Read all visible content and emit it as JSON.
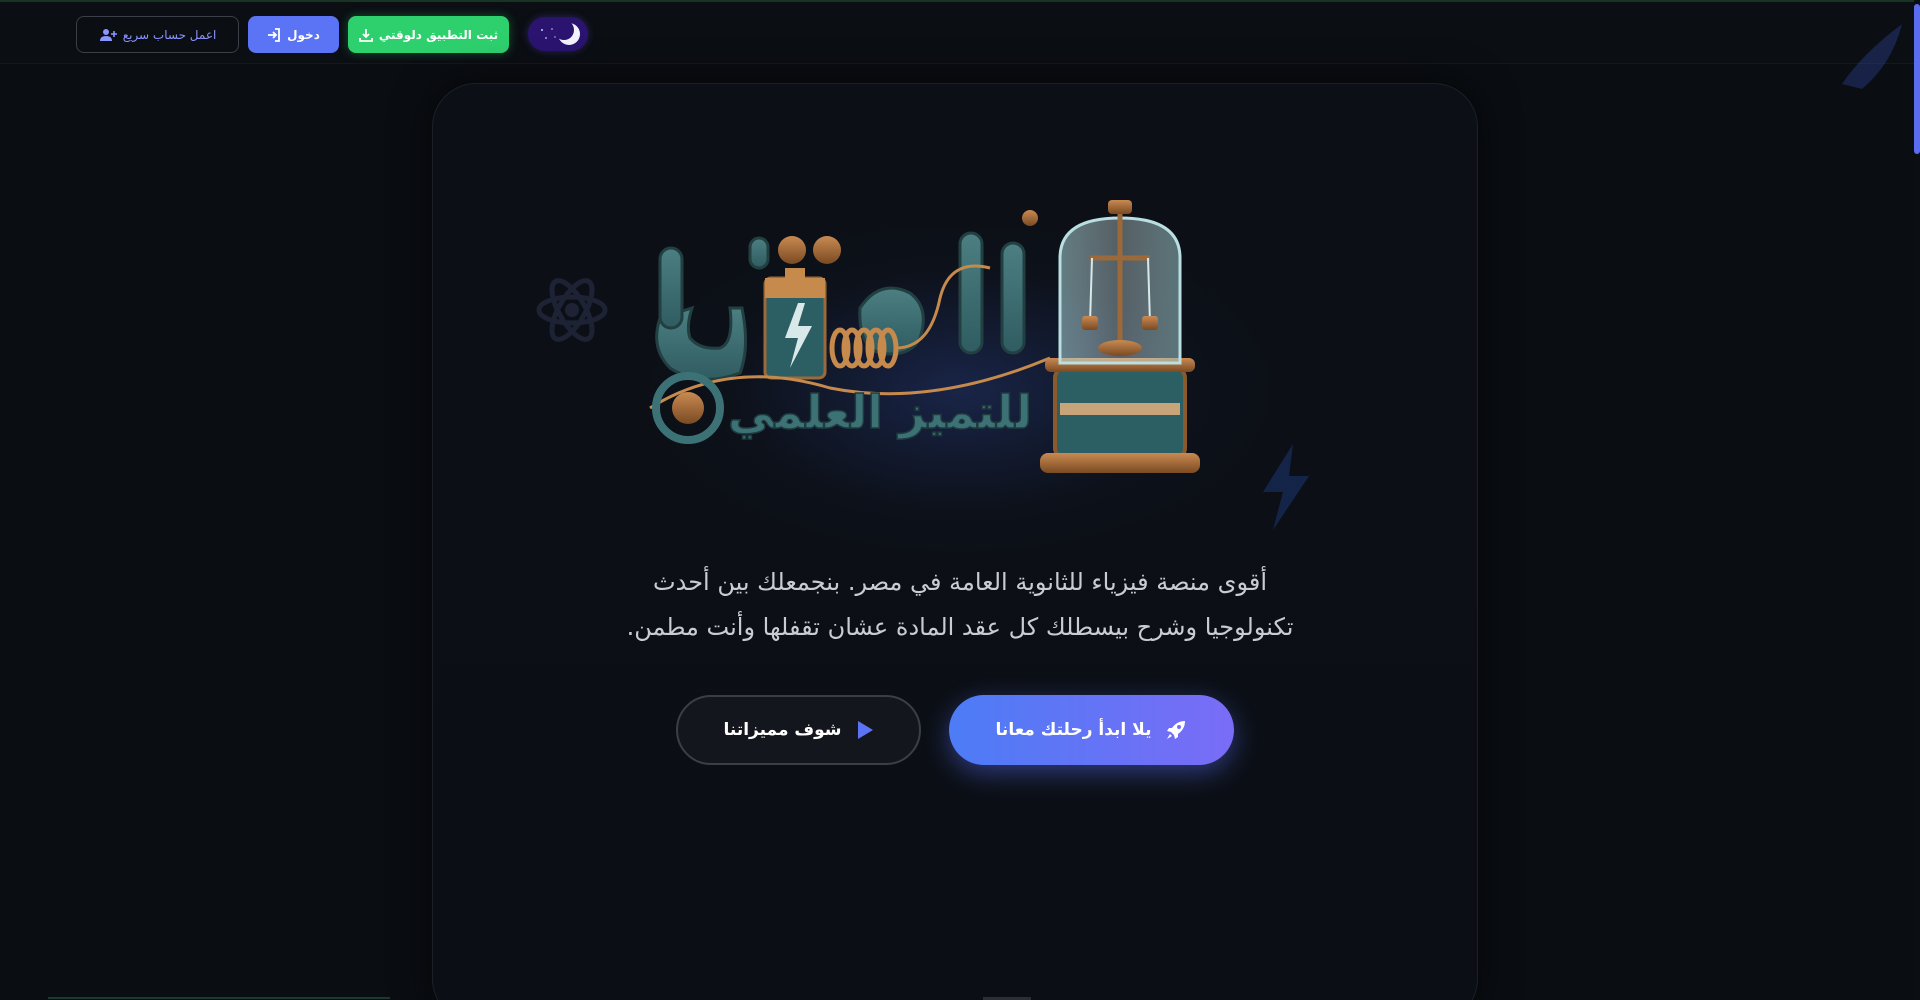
{
  "header": {
    "signup_label": "اعمل حساب سريع",
    "login_label": "دخول",
    "install_label": "ثبت التطبيق دلوقتي",
    "theme_toggle": "dark-mode",
    "colors": {
      "login": "#5b73f5",
      "install": "#2ed06e",
      "signup_text": "#8b95ff"
    },
    "icons": {
      "signup": "user-plus-icon",
      "login": "sign-in-icon",
      "install": "download-icon",
      "theme": "moon-icon"
    }
  },
  "hero": {
    "logo": {
      "title": "الأوائل",
      "subtitle": "للتميز العلمي"
    },
    "description_line1": "أقوى منصة فيزياء للثانوية العامة في مصر. بنجمعلك بين أحدث",
    "description_line2": "تكنولوجيا وشرح بيسطلك كل عقد المادة عشان تقفلها وأنت مطمن.",
    "cta_primary": {
      "label": "يلا ابدأ رحلتك معانا",
      "icon": "rocket-icon"
    },
    "cta_secondary": {
      "label": "شوف مميزاتنا",
      "icon": "play-icon"
    }
  }
}
